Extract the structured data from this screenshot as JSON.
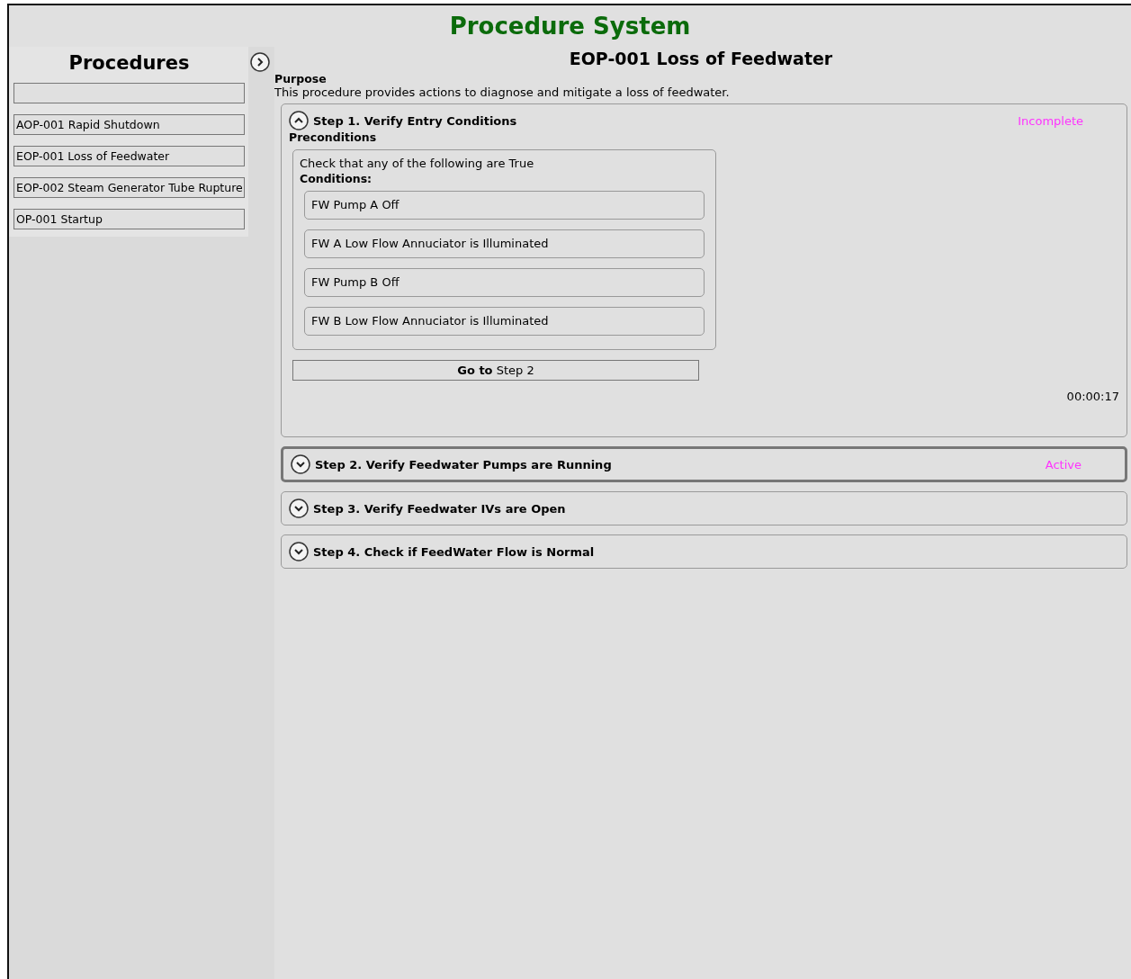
{
  "app_title": "Procedure System",
  "sidebar": {
    "title": "Procedures",
    "items": [
      {
        "label": "AOP-001 Rapid Shutdown",
        "selected": false
      },
      {
        "label": "EOP-001 Loss of Feedwater",
        "selected": false
      },
      {
        "label": "EOP-002 Steam Generator Tube Rupture",
        "selected": false
      },
      {
        "label": "OP-001 Startup",
        "selected": false
      }
    ]
  },
  "procedure": {
    "title": "EOP-001 Loss of Feedwater",
    "purpose_label": "Purpose",
    "purpose": "This procedure provides actions to diagnose and mitigate a loss of feedwater.",
    "steps": [
      {
        "title": "Step 1. Verify Entry Conditions",
        "expanded": true,
        "selected": false,
        "status": "Incomplete",
        "section_label": "Preconditions",
        "instruction": "Check that any of the following are True",
        "conditions_label": "Conditions:",
        "conditions": [
          "FW Pump A Off",
          "FW A Low Flow Annuciator is Illuminated",
          "FW Pump B Off",
          "FW B Low Flow Annuciator is Illuminated"
        ],
        "goto": "**Go to** Step 2",
        "timer": "00:00:17"
      },
      {
        "title": "Step 2. Verify Feedwater Pumps are Running",
        "expanded": false,
        "selected": true,
        "status": "Active"
      },
      {
        "title": "Step 3. Verify Feedwater IVs are Open",
        "expanded": false,
        "selected": false
      },
      {
        "title": "Step 4. Check if FeedWater Flow is Normal",
        "expanded": false,
        "selected": false
      }
    ]
  }
}
